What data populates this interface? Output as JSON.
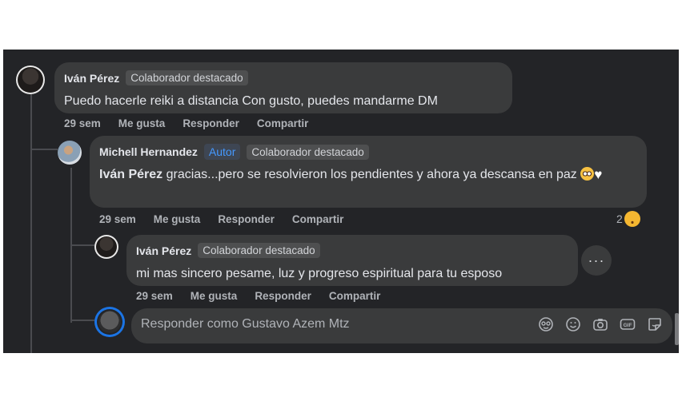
{
  "comment1": {
    "name": "Iván Pérez",
    "badge": "Colaborador destacado",
    "text": "Puedo hacerle reiki a distancia Con gusto, puedes mandarme DM",
    "time": "29 sem",
    "like": "Me gusta",
    "reply": "Responder",
    "share": "Compartir"
  },
  "comment2": {
    "name": "Michell Hernandez",
    "author_badge": "Autor",
    "badge": "Colaborador destacado",
    "mention": "Iván Pérez",
    "text": " gracias...pero se resolvieron los pendientes y ahora ya descansa en paz ",
    "time": "29 sem",
    "like": "Me gusta",
    "reply": "Responder",
    "share": "Compartir",
    "reaction_count": "2"
  },
  "comment3": {
    "name": "Iván Pérez",
    "badge": "Colaborador destacado",
    "text": "mi mas sincero pesame, luz y progreso espiritual para tu esposo",
    "time": "29 sem",
    "like": "Me gusta",
    "reply": "Responder",
    "share": "Compartir",
    "more": "···"
  },
  "reply_box": {
    "placeholder": "Responder como Gustavo Azem Mtz",
    "tools": [
      "avatar-sticker-icon",
      "emoji-icon",
      "camera-icon",
      "gif-icon",
      "sticker-icon"
    ]
  },
  "colors": {
    "background": "#232427",
    "bubble": "#3a3b3c",
    "text": "#e4e6eb",
    "muted": "#b0b3b8",
    "author": "#4599ff"
  }
}
